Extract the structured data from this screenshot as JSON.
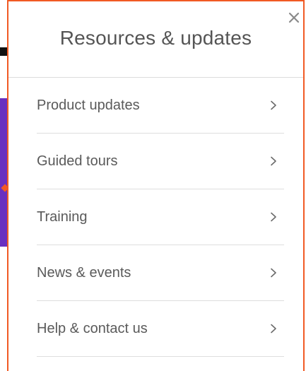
{
  "panel": {
    "title": "Resources & updates",
    "close_icon": "close-icon",
    "accent_color": "#f15a24"
  },
  "menu": {
    "items": [
      {
        "label": "Product updates",
        "icon": "chevron-right-icon"
      },
      {
        "label": "Guided tours",
        "icon": "chevron-right-icon"
      },
      {
        "label": "Training",
        "icon": "chevron-right-icon"
      },
      {
        "label": "News & events",
        "icon": "chevron-right-icon"
      },
      {
        "label": "Help & contact us",
        "icon": "chevron-right-icon"
      }
    ]
  },
  "background": {
    "purple_color": "#6a2fc0",
    "black_color": "#111111"
  }
}
